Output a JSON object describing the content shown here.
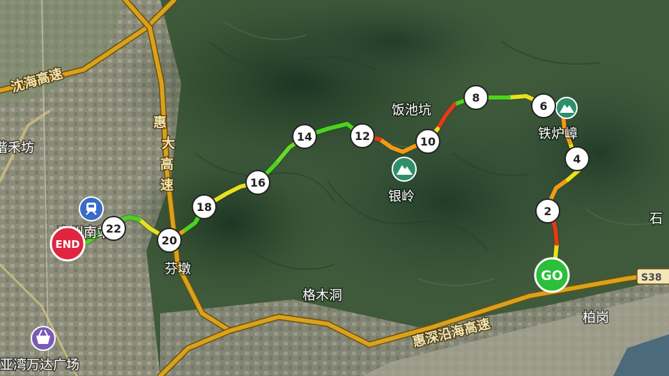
{
  "map": {
    "place_labels": {
      "fanchikeng": "饭池坑",
      "tiedong": "铁炉嶂",
      "yinling": "银岭",
      "fendun": "芬墩",
      "gemudong": "格木洞",
      "baigang": "柏岗",
      "xiehe": "谐禾坊",
      "wanda": "亚湾万达广场",
      "station": "惠州南站",
      "shi": "石"
    },
    "roads": {
      "shenhai": "沈海高速",
      "huida": [
        "惠",
        "大",
        "高",
        "速"
      ],
      "huishen": "惠深沿海高速",
      "s38": "S38"
    },
    "markers": {
      "start": "GO",
      "end": "END"
    },
    "km_markers": [
      "2",
      "4",
      "6",
      "8",
      "10",
      "12",
      "14",
      "16",
      "18",
      "20",
      "22"
    ],
    "colors": {
      "route_green": "#4cd31f",
      "route_yellow": "#e8e021",
      "route_orange": "#f39a15",
      "route_red": "#e23a1a",
      "start_marker": "#2bbf3a",
      "end_marker": "#e0263f",
      "road": "#d9a21d",
      "poi": "#2f8f6b"
    },
    "icons": {
      "peak_icon": "mountain",
      "station_icon": "train",
      "mall_icon": "shopping-basket"
    }
  }
}
